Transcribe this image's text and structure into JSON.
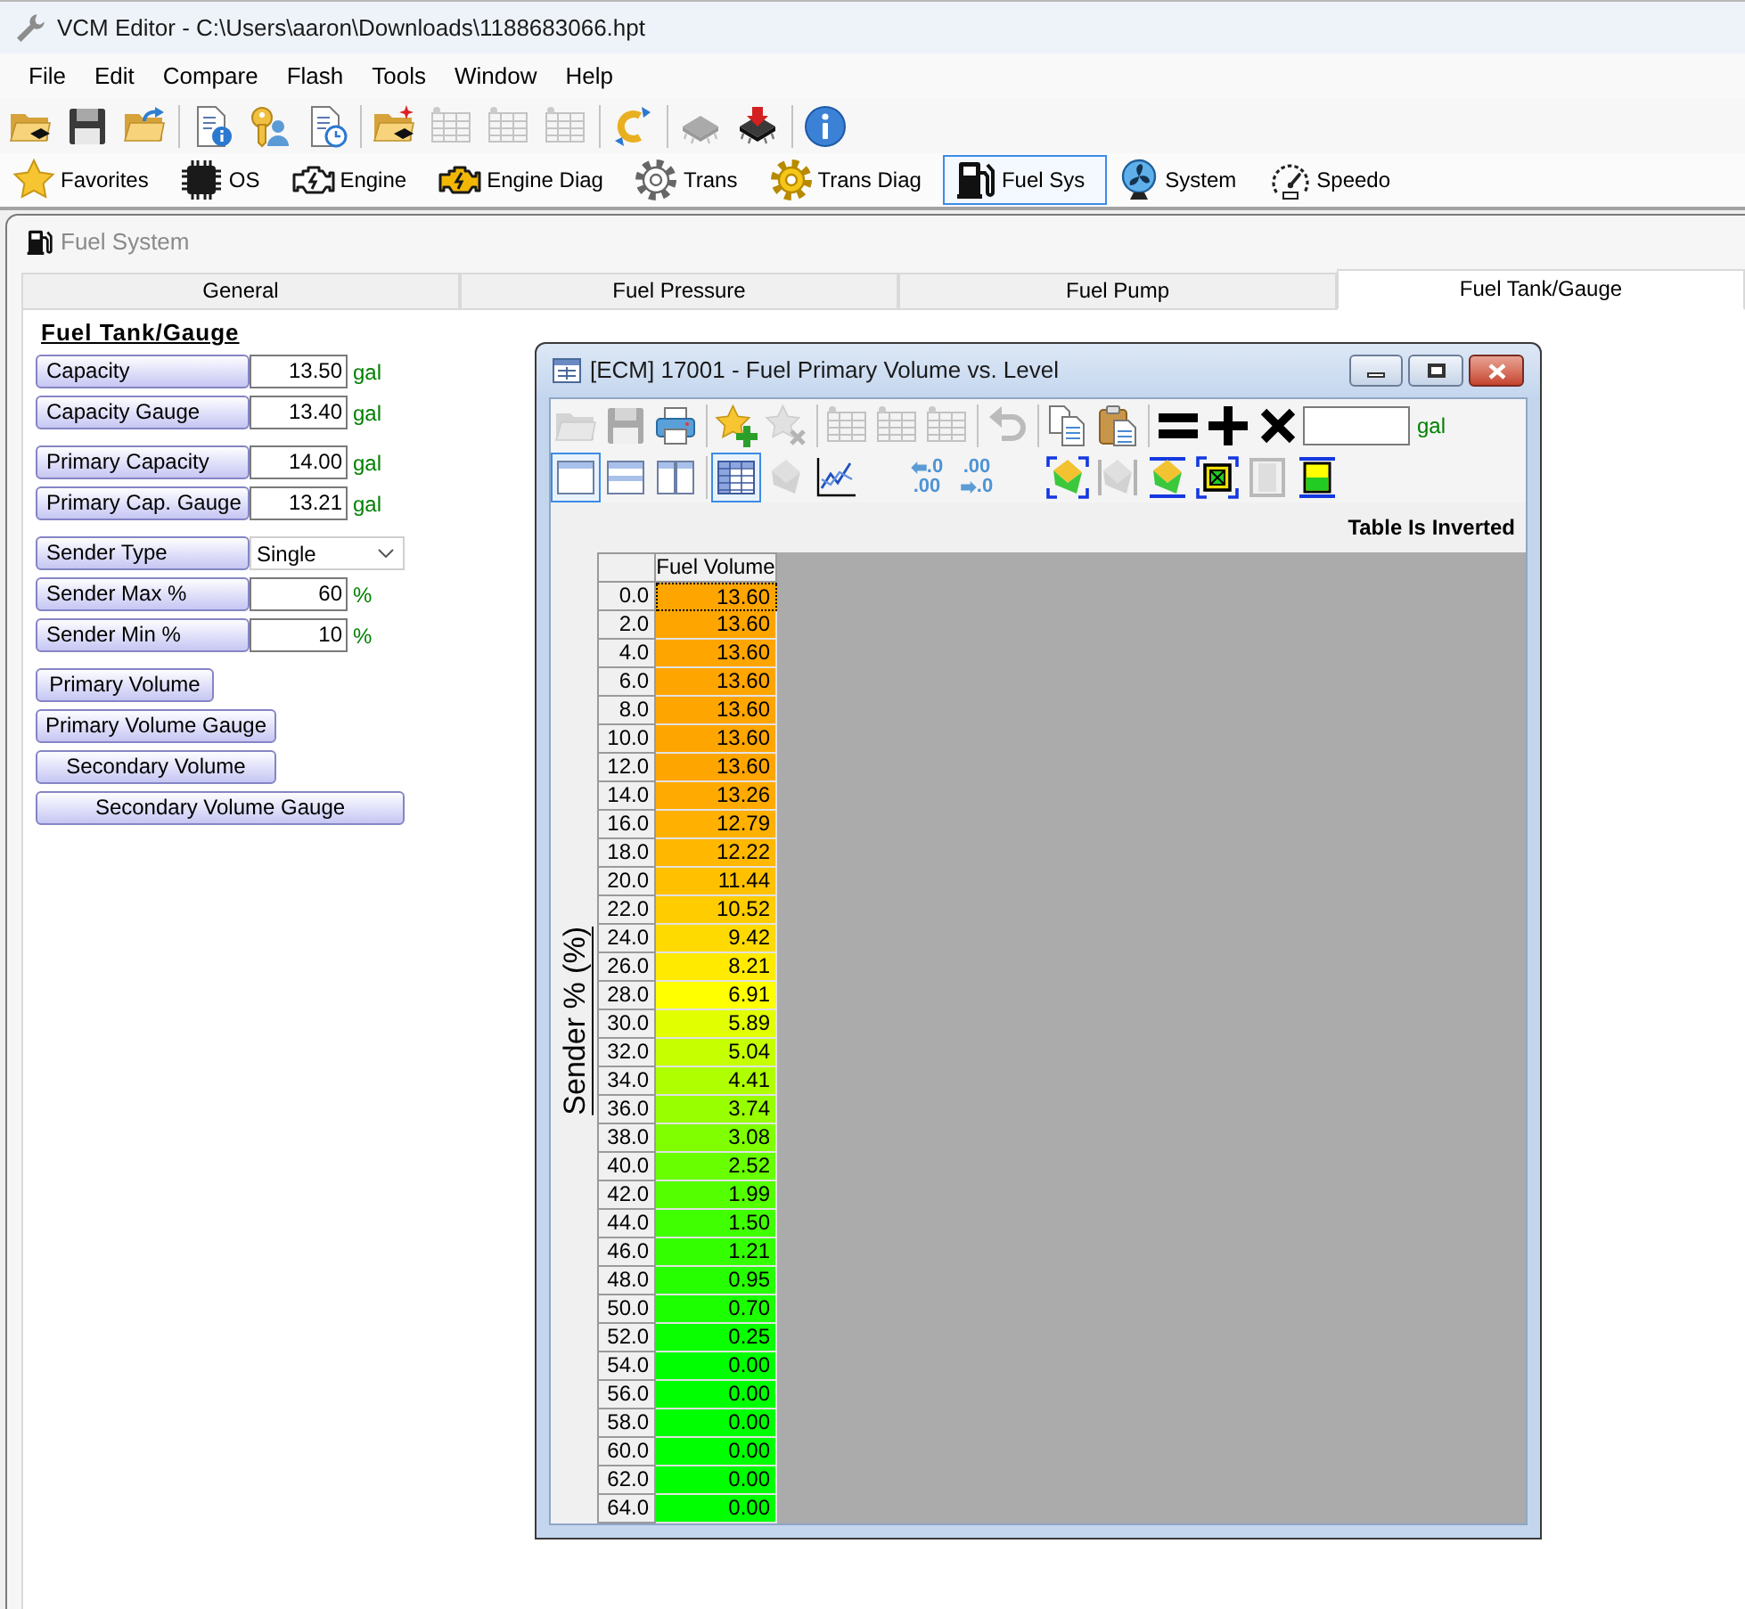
{
  "window": {
    "title": "VCM Editor - C:\\Users\\aaron\\Downloads\\1188683066.hpt"
  },
  "menu": [
    "File",
    "Edit",
    "Compare",
    "Flash",
    "Tools",
    "Window",
    "Help"
  ],
  "toolbar": [
    {
      "kind": "open",
      "disabled": false
    },
    {
      "kind": "save",
      "disabled": false
    },
    {
      "kind": "reopen",
      "disabled": false
    },
    {
      "kind": "separator"
    },
    {
      "kind": "docinfo",
      "disabled": false
    },
    {
      "kind": "key",
      "disabled": false
    },
    {
      "kind": "log",
      "disabled": false
    },
    {
      "kind": "separator"
    },
    {
      "kind": "load",
      "disabled": false
    },
    {
      "kind": "table",
      "disabled": true
    },
    {
      "kind": "table",
      "disabled": true
    },
    {
      "kind": "table",
      "disabled": true
    },
    {
      "kind": "separator"
    },
    {
      "kind": "convert",
      "disabled": false
    },
    {
      "kind": "separator"
    },
    {
      "kind": "chip",
      "disabled": true
    },
    {
      "kind": "flash",
      "disabled": false
    },
    {
      "kind": "separator"
    },
    {
      "kind": "about",
      "disabled": false
    }
  ],
  "modules": [
    {
      "label": "Favorites",
      "selected": false
    },
    {
      "label": "OS",
      "selected": false
    },
    {
      "label": "Engine",
      "selected": false
    },
    {
      "label": "Engine Diag",
      "selected": false
    },
    {
      "label": "Trans",
      "selected": false
    },
    {
      "label": "Trans Diag",
      "selected": false
    },
    {
      "label": "Fuel Sys",
      "selected": true
    },
    {
      "label": "System",
      "selected": false
    },
    {
      "label": "Speedo",
      "selected": false
    }
  ],
  "fuel_system": {
    "title": "Fuel System",
    "tabs": [
      {
        "label": "General",
        "selected": false
      },
      {
        "label": "Fuel Pressure",
        "selected": false
      },
      {
        "label": "Fuel Pump",
        "selected": false
      },
      {
        "label": "Fuel Tank/Gauge",
        "selected": true
      }
    ],
    "heading": "Fuel Tank/Gauge",
    "field_groups": [
      {
        "fields": [
          {
            "kind": "number",
            "label": "Capacity",
            "value": "13.50",
            "unit": "gal"
          },
          {
            "kind": "number",
            "label": "Capacity Gauge",
            "value": "13.40",
            "unit": "gal"
          }
        ]
      },
      {
        "fields": [
          {
            "kind": "number",
            "label": "Primary Capacity",
            "value": "14.00",
            "unit": "gal"
          },
          {
            "kind": "number",
            "label": "Primary Cap. Gauge",
            "value": "13.21",
            "unit": "gal"
          }
        ]
      },
      {
        "fields": [
          {
            "kind": "dropdown",
            "label": "Sender Type",
            "value": "Single"
          },
          {
            "kind": "number",
            "label": "Sender Max %",
            "value": "60",
            "unit": "%"
          },
          {
            "kind": "number",
            "label": "Sender Min %",
            "value": "10",
            "unit": "%"
          }
        ]
      }
    ],
    "buttons": [
      "Primary Volume",
      "Primary Volume Gauge",
      "Secondary Volume",
      "Secondary Volume Gauge"
    ]
  },
  "table_window": {
    "title": "[ECM] 17001 - Fuel Primary Volume vs. Level",
    "toolbar": [
      {
        "kind": "folder",
        "disabled": true
      },
      {
        "kind": "save",
        "disabled": true
      },
      {
        "kind": "print",
        "disabled": false
      },
      {
        "kind": "separator"
      },
      {
        "kind": "favorite",
        "disabled": false
      },
      {
        "kind": "unfavorite",
        "disabled": true
      },
      {
        "kind": "separator"
      },
      {
        "kind": "table",
        "disabled": true
      },
      {
        "kind": "table",
        "disabled": true
      },
      {
        "kind": "table",
        "disabled": true
      },
      {
        "kind": "separator"
      },
      {
        "kind": "undo",
        "disabled": true
      },
      {
        "kind": "separator"
      },
      {
        "kind": "copy",
        "disabled": false
      },
      {
        "kind": "paste",
        "disabled": false
      },
      {
        "kind": "separator"
      },
      {
        "kind": "equals",
        "disabled": false
      },
      {
        "kind": "plus",
        "disabled": false
      },
      {
        "kind": "multiply",
        "disabled": false
      }
    ],
    "unit": "gal",
    "view_tools": [
      {
        "kind": "single",
        "selected": true,
        "disabled": false
      },
      {
        "kind": "rows",
        "selected": false,
        "disabled": false
      },
      {
        "kind": "columns",
        "selected": false,
        "disabled": false
      },
      {
        "kind": "separator"
      },
      {
        "kind": "grid",
        "selected": true,
        "disabled": false
      },
      {
        "kind": "surface",
        "selected": false,
        "disabled": true
      },
      {
        "kind": "graph",
        "selected": false,
        "disabled": false
      },
      {
        "kind": "space"
      },
      {
        "kind": "decimals",
        "arrow_top": true,
        "top": ".0",
        "bottom": ".00",
        "disabled": false
      },
      {
        "kind": "decimals",
        "arrow_top": false,
        "top": ".00",
        "bottom": ".0",
        "disabled": false
      },
      {
        "kind": "space"
      },
      {
        "kind": "view3d",
        "selected": false,
        "disabled": false
      },
      {
        "kind": "surface2",
        "selected": false,
        "disabled": true
      },
      {
        "kind": "flat",
        "selected": false,
        "disabled": false
      },
      {
        "kind": "cross",
        "selected": false,
        "disabled": false
      },
      {
        "kind": "frame",
        "selected": false,
        "disabled": true
      },
      {
        "kind": "fill",
        "selected": false,
        "disabled": false
      }
    ],
    "notice": "Table Is Inverted",
    "axis_label": "Sender % (%)",
    "column": "Fuel Volume",
    "rows": [
      {
        "axis": "0.0",
        "value": "13.60",
        "color": "#ffa500",
        "selected": true
      },
      {
        "axis": "2.0",
        "value": "13.60",
        "color": "#ffa500",
        "selected": false
      },
      {
        "axis": "4.0",
        "value": "13.60",
        "color": "#ffa500",
        "selected": false
      },
      {
        "axis": "6.0",
        "value": "13.60",
        "color": "#ffa500",
        "selected": false
      },
      {
        "axis": "8.0",
        "value": "13.60",
        "color": "#ffa500",
        "selected": false
      },
      {
        "axis": "10.0",
        "value": "13.60",
        "color": "#ffa500",
        "selected": false
      },
      {
        "axis": "12.0",
        "value": "13.60",
        "color": "#ffa500",
        "selected": false
      },
      {
        "axis": "14.0",
        "value": "13.26",
        "color": "#ffaa00",
        "selected": false
      },
      {
        "axis": "16.0",
        "value": "12.79",
        "color": "#ffb000",
        "selected": false
      },
      {
        "axis": "18.0",
        "value": "12.22",
        "color": "#ffb700",
        "selected": false
      },
      {
        "axis": "20.0",
        "value": "11.44",
        "color": "#ffc000",
        "selected": false
      },
      {
        "axis": "22.0",
        "value": "10.52",
        "color": "#ffcc00",
        "selected": false
      },
      {
        "axis": "24.0",
        "value": "9.42",
        "color": "#ffda00",
        "selected": false
      },
      {
        "axis": "26.0",
        "value": "8.21",
        "color": "#ffea00",
        "selected": false
      },
      {
        "axis": "28.0",
        "value": "6.91",
        "color": "#ffff00",
        "selected": false
      },
      {
        "axis": "30.0",
        "value": "5.89",
        "color": "#e2ff00",
        "selected": false
      },
      {
        "axis": "32.0",
        "value": "5.04",
        "color": "#c6ff00",
        "selected": false
      },
      {
        "axis": "34.0",
        "value": "4.41",
        "color": "#b0ff00",
        "selected": false
      },
      {
        "axis": "36.0",
        "value": "3.74",
        "color": "#98ff00",
        "selected": false
      },
      {
        "axis": "38.0",
        "value": "3.08",
        "color": "#7fff00",
        "selected": false
      },
      {
        "axis": "40.0",
        "value": "2.52",
        "color": "#68ff00",
        "selected": false
      },
      {
        "axis": "42.0",
        "value": "1.99",
        "color": "#54ff00",
        "selected": false
      },
      {
        "axis": "44.0",
        "value": "1.50",
        "color": "#40ff00",
        "selected": false
      },
      {
        "axis": "46.0",
        "value": "1.21",
        "color": "#33ff00",
        "selected": false
      },
      {
        "axis": "48.0",
        "value": "0.95",
        "color": "#26ff00",
        "selected": false
      },
      {
        "axis": "50.0",
        "value": "0.70",
        "color": "#1cff00",
        "selected": false
      },
      {
        "axis": "52.0",
        "value": "0.25",
        "color": "#0aff00",
        "selected": false
      },
      {
        "axis": "54.0",
        "value": "0.00",
        "color": "#00ff00",
        "selected": false
      },
      {
        "axis": "56.0",
        "value": "0.00",
        "color": "#00ff00",
        "selected": false
      },
      {
        "axis": "58.0",
        "value": "0.00",
        "color": "#00ff00",
        "selected": false
      },
      {
        "axis": "60.0",
        "value": "0.00",
        "color": "#00ff00",
        "selected": false
      },
      {
        "axis": "62.0",
        "value": "0.00",
        "color": "#00ff00",
        "selected": false
      },
      {
        "axis": "64.0",
        "value": "0.00",
        "color": "#00ff00",
        "selected": false
      }
    ]
  }
}
